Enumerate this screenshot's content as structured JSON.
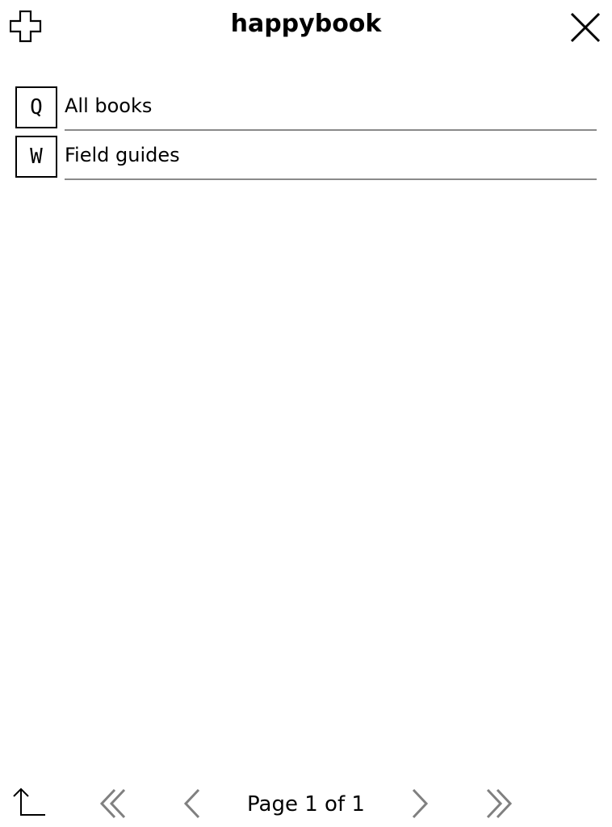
{
  "header": {
    "title": "happybook",
    "left_icon": "plus-outline-icon",
    "right_icon": "close-icon"
  },
  "list": {
    "items": [
      {
        "key": "Q",
        "label": "All books"
      },
      {
        "key": "W",
        "label": "Field guides"
      }
    ]
  },
  "footer": {
    "page_label": "Page 1 of 1",
    "icons": [
      "go-up-icon",
      "first-page-icon",
      "previous-page-icon",
      "next-page-icon",
      "last-page-icon"
    ]
  },
  "colors": {
    "text": "#000000",
    "divider": "#8a8a8a",
    "disabled_nav": "#808080",
    "background": "#ffffff"
  }
}
